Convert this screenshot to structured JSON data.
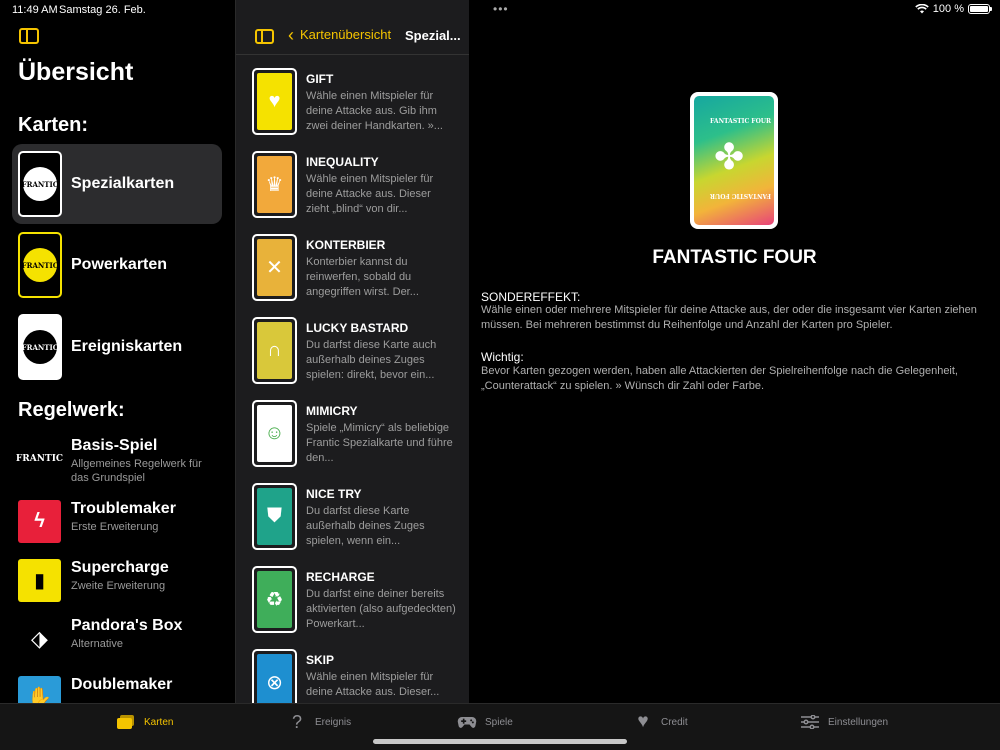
{
  "status": {
    "time": "11:49 AM",
    "date": "Samstag 26. Feb.",
    "battery": "100 %",
    "battery_level": 100
  },
  "sidebar": {
    "title": "Übersicht",
    "cards_heading": "Karten:",
    "cards": [
      {
        "label": "Spezialkarten",
        "logo": "FRANTIC"
      },
      {
        "label": "Powerkarten",
        "logo": "FRANTIC"
      },
      {
        "label": "Ereigniskarten",
        "logo": "FRANTIC"
      }
    ],
    "rules_heading": "Regelwerk:",
    "rules": [
      {
        "title": "Basis-Spiel",
        "subtitle": "Allgemeines Regelwerk für das Grundspiel",
        "icon": "frantic-logo",
        "icon_color": "#000000"
      },
      {
        "title": "Troublemaker",
        "subtitle": "Erste Erweiterung",
        "icon": "lightning-icon",
        "icon_color": "#e8203a"
      },
      {
        "title": "Supercharge",
        "subtitle": "Zweite Erweiterung",
        "icon": "battery-icon",
        "icon_color": "#f5e200"
      },
      {
        "title": "Pandora's Box",
        "subtitle": "Alternative",
        "icon": "box-icon",
        "icon_color": "#000000"
      },
      {
        "title": "Doublemaker",
        "subtitle": "",
        "icon": "hand-icon",
        "icon_color": "#2a9bd8"
      }
    ]
  },
  "middle": {
    "back_label": "Kartenübersicht",
    "title": "Spezial...",
    "items": [
      {
        "title": "GIFT",
        "desc": "Wähle einen Mitspieler für deine Attacke aus. Gib ihm zwei deiner Handkarten. »...",
        "color": "#f5e200",
        "icon": "heart-icon",
        "glyph": "♥"
      },
      {
        "title": "INEQUALITY",
        "desc": "Wähle einen Mitspieler für deine Attacke aus. Dieser zieht „blind“ von dir...",
        "color": "#f2a93b",
        "icon": "crown-icon",
        "glyph": "♛"
      },
      {
        "title": "KONTERBIER",
        "desc": "Konterbier kannst du reinwerfen, sobald du angegriffen wirst. Der...",
        "color": "#e8b23a",
        "icon": "crossed-tools-icon",
        "glyph": "✕"
      },
      {
        "title": "LUCKY BASTARD",
        "desc": "Du darfst diese Karte auch außerhalb deines Zuges spielen: direkt, bevor ein...",
        "color": "#d9c83a",
        "icon": "horseshoe-icon",
        "glyph": "∩"
      },
      {
        "title": "MIMICRY",
        "desc": "Spiele „Mimicry“ als beliebige Frantic Spezialkarte und führe den...",
        "color": "#ffffff",
        "icon": "masks-icon",
        "glyph": "☺"
      },
      {
        "title": "NICE TRY",
        "desc": "Du darfst diese Karte außerhalb deines Zuges spielen, wenn ein...",
        "color": "#1fa38a",
        "icon": "shield-icon",
        "glyph": "⛊"
      },
      {
        "title": "RECHARGE",
        "desc": "Du darfst eine deiner bereits aktivierten (also aufgedeckten) Powerkart...",
        "color": "#3fae5a",
        "icon": "recycle-card-icon",
        "glyph": "♻"
      },
      {
        "title": "SKIP",
        "desc": "Wähle einen Mitspieler für deine Attacke aus. Dieser...",
        "color": "#1e8fd0",
        "icon": "skip-icon",
        "glyph": "⊗"
      }
    ]
  },
  "detail": {
    "card_name": "FANTASTIC FOUR",
    "card_label_top": "FANTASTIC FOUR",
    "card_label_bottom": "FANTASTIC FOUR",
    "sections": [
      {
        "heading": "SONDEREFFEKT:",
        "text": "Wähle einen oder mehrere Mitspieler für deine Attacke aus, der oder die insgesamt vier Karten ziehen müssen. Bei mehreren bestimmst du Reihenfolge und Anzahl der Karten pro Spieler."
      },
      {
        "heading": "Wichtig:",
        "text": "Bevor Karten gezogen werden, haben alle Attackierten der Spielreihenfolge nach die Gelegenheit, „Counterattack“ zu spielen. » Wünsch dir Zahl oder Farbe."
      }
    ]
  },
  "tabs": [
    {
      "label": "Karten",
      "icon": "cards-icon",
      "glyph": "▰",
      "active": true
    },
    {
      "label": "Ereignis",
      "icon": "question-icon",
      "glyph": "?",
      "active": false
    },
    {
      "label": "Spiele",
      "icon": "gamepad-icon",
      "glyph": "⌨",
      "active": false
    },
    {
      "label": "Credit",
      "icon": "heart-icon",
      "glyph": "♥",
      "active": false
    },
    {
      "label": "Einstellungen",
      "icon": "sliders-icon",
      "glyph": "≡",
      "active": false
    }
  ],
  "colors": {
    "accent": "#f5c400",
    "selected_row": "#2c2c2e",
    "list_bg": "#1c1c1e"
  }
}
